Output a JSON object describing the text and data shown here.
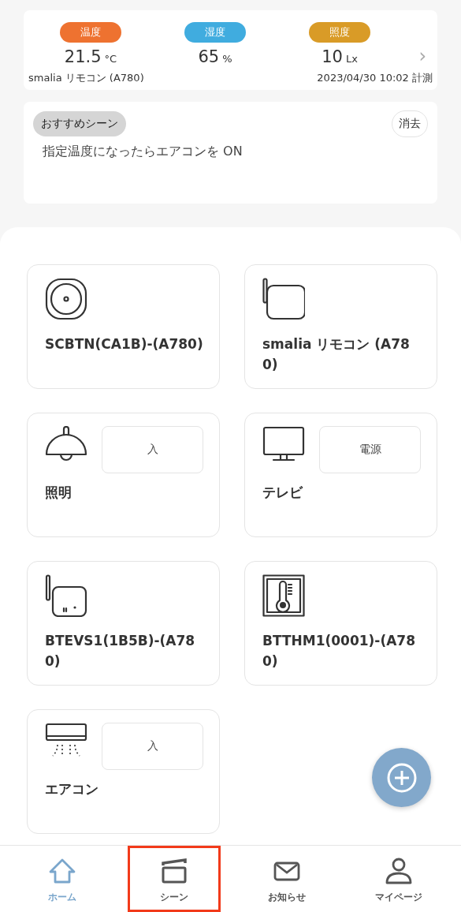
{
  "sensor_card": {
    "readings": [
      {
        "label": "温度",
        "color": "#ee7230",
        "value": "21.5",
        "unit": "°C"
      },
      {
        "label": "湿度",
        "color": "#40acdf",
        "value": "65",
        "unit": "%"
      },
      {
        "label": "照度",
        "color": "#d99b27",
        "value": "10",
        "unit": "Lx"
      }
    ],
    "chevron": "›",
    "device": "smalia リモコン (A780)",
    "measured": "2023/04/30 10:02 計測"
  },
  "recommend": {
    "tag": "おすすめシーン",
    "dismiss": "消去",
    "text": "指定温度になったらエアコンを ON"
  },
  "devices": [
    {
      "kind": "button",
      "name": "SCBTN(CA1B)-(A780)"
    },
    {
      "kind": "remote",
      "name": "smalia リモコン (A780)"
    },
    {
      "kind": "light",
      "name": "照明",
      "action": "入"
    },
    {
      "kind": "tv",
      "name": "テレビ",
      "action": "電源"
    },
    {
      "kind": "sensor",
      "name": "BTEVS1(1B5B)-(A780)"
    },
    {
      "kind": "thermometer",
      "name": "BTTHM1(0001)-(A780)"
    },
    {
      "kind": "aircon",
      "name": "エアコン",
      "action": "入"
    }
  ],
  "tabs": [
    {
      "kind": "home",
      "label": "ホーム",
      "selected": true,
      "highlighted": false
    },
    {
      "kind": "scene",
      "label": "シーン",
      "selected": false,
      "highlighted": true
    },
    {
      "kind": "mail",
      "label": "お知らせ",
      "selected": false,
      "highlighted": false
    },
    {
      "kind": "person",
      "label": "マイページ",
      "selected": false,
      "highlighted": false
    }
  ]
}
